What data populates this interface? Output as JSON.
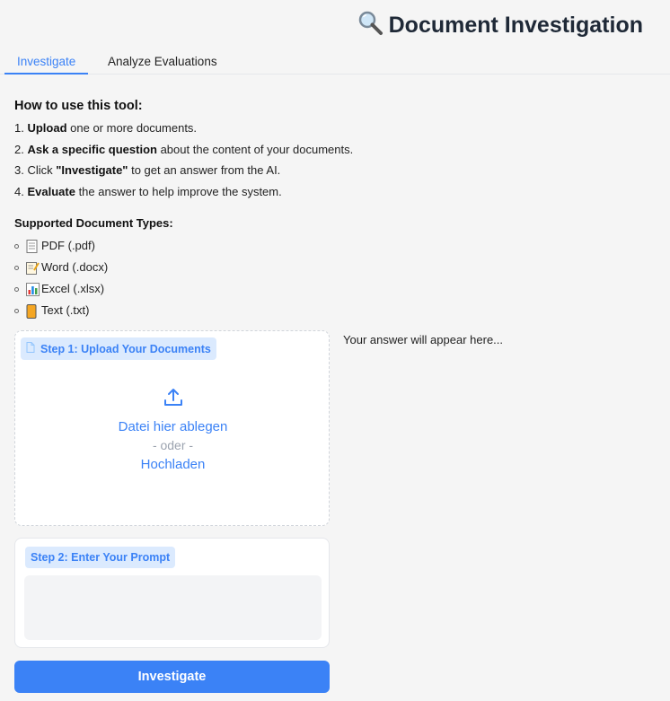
{
  "app": {
    "title": "Document Investigation",
    "title_icon": "magnifying-glass-icon"
  },
  "tabs": [
    {
      "label": "Investigate",
      "active": true
    },
    {
      "label": "Analyze Evaluations",
      "active": false
    }
  ],
  "howto": {
    "heading": "How to use this tool:",
    "steps": [
      {
        "num": "1.",
        "bold": "Upload",
        "rest": " one or more documents."
      },
      {
        "num": "2.",
        "bold": "Ask a specific question",
        "rest": " about the content of your documents."
      },
      {
        "num": "3.",
        "pre": " Click ",
        "bold": "\"Investigate\"",
        "rest": " to get an answer from the AI."
      },
      {
        "num": "4.",
        "bold": "Evaluate",
        "rest": " the answer to help improve the system."
      }
    ]
  },
  "types": {
    "heading": "Supported Document Types:",
    "items": [
      {
        "label": "PDF (.pdf)",
        "icon": "page-icon"
      },
      {
        "label": "Word (.docx)",
        "icon": "memo-icon"
      },
      {
        "label": "Excel (.xlsx)",
        "icon": "bar-chart-icon"
      },
      {
        "label": "Text (.txt)",
        "icon": "text-file-icon"
      }
    ]
  },
  "upload": {
    "step_label": "Step 1: Upload Your Documents",
    "drop_text": "Datei hier ablegen",
    "or_text": "- oder -",
    "browse_text": "Hochladen"
  },
  "answer": {
    "placeholder": "Your answer will appear here..."
  },
  "prompt": {
    "step_label": "Step 2: Enter Your Prompt",
    "value": ""
  },
  "actions": {
    "investigate_label": "Investigate"
  },
  "colors": {
    "accent": "#3b82f6",
    "accent_light": "#dbeafe"
  }
}
